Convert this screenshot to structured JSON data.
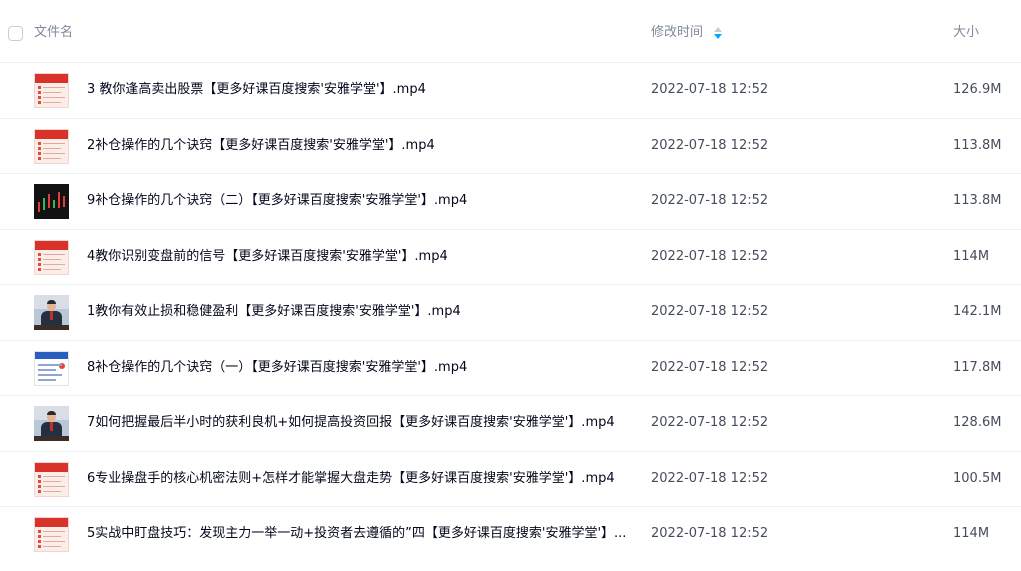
{
  "header": {
    "name_label": "文件名",
    "modified_label": "修改时间",
    "size_label": "大小",
    "sort_state": "descending"
  },
  "colors": {
    "accent": "#06a7ff",
    "header_text": "#818999",
    "name_text": "#03081a",
    "meta_text": "#454d5a"
  },
  "files": [
    {
      "name": "3 教你逢高卖出股票【更多好课百度搜索'安雅学堂'】.mp4",
      "modified": "2022-07-18 12:52",
      "size": "126.9M",
      "thumb": "document"
    },
    {
      "name": "2补仓操作的几个诀窍【更多好课百度搜索'安雅学堂'】.mp4",
      "modified": "2022-07-18 12:52",
      "size": "113.8M",
      "thumb": "document"
    },
    {
      "name": "9补仓操作的几个诀窍（二）【更多好课百度搜索'安雅学堂'】.mp4",
      "modified": "2022-07-18 12:52",
      "size": "113.8M",
      "thumb": "chart"
    },
    {
      "name": "4教你识别变盘前的信号【更多好课百度搜索'安雅学堂'】.mp4",
      "modified": "2022-07-18 12:52",
      "size": "114M",
      "thumb": "document"
    },
    {
      "name": "1教你有效止损和稳健盈利【更多好课百度搜索'安雅学堂'】.mp4",
      "modified": "2022-07-18 12:52",
      "size": "142.1M",
      "thumb": "person"
    },
    {
      "name": "8补仓操作的几个诀窍（一）【更多好课百度搜索'安雅学堂'】.mp4",
      "modified": "2022-07-18 12:52",
      "size": "117.8M",
      "thumb": "slide"
    },
    {
      "name": "7如何把握最后半小时的获利良机+如何提高投资回报【更多好课百度搜索'安雅学堂'】.mp4",
      "modified": "2022-07-18 12:52",
      "size": "128.6M",
      "thumb": "person"
    },
    {
      "name": "6专业操盘手的核心机密法则+怎样才能掌握大盘走势【更多好课百度搜索'安雅学堂'】.mp4",
      "modified": "2022-07-18 12:52",
      "size": "100.5M",
      "thumb": "document"
    },
    {
      "name": "5实战中盯盘技巧：发现主力一举一动+投资者去遵循的”四【更多好课百度搜索'安雅学堂'】...",
      "modified": "2022-07-18 12:52",
      "size": "114M",
      "thumb": "document"
    }
  ]
}
